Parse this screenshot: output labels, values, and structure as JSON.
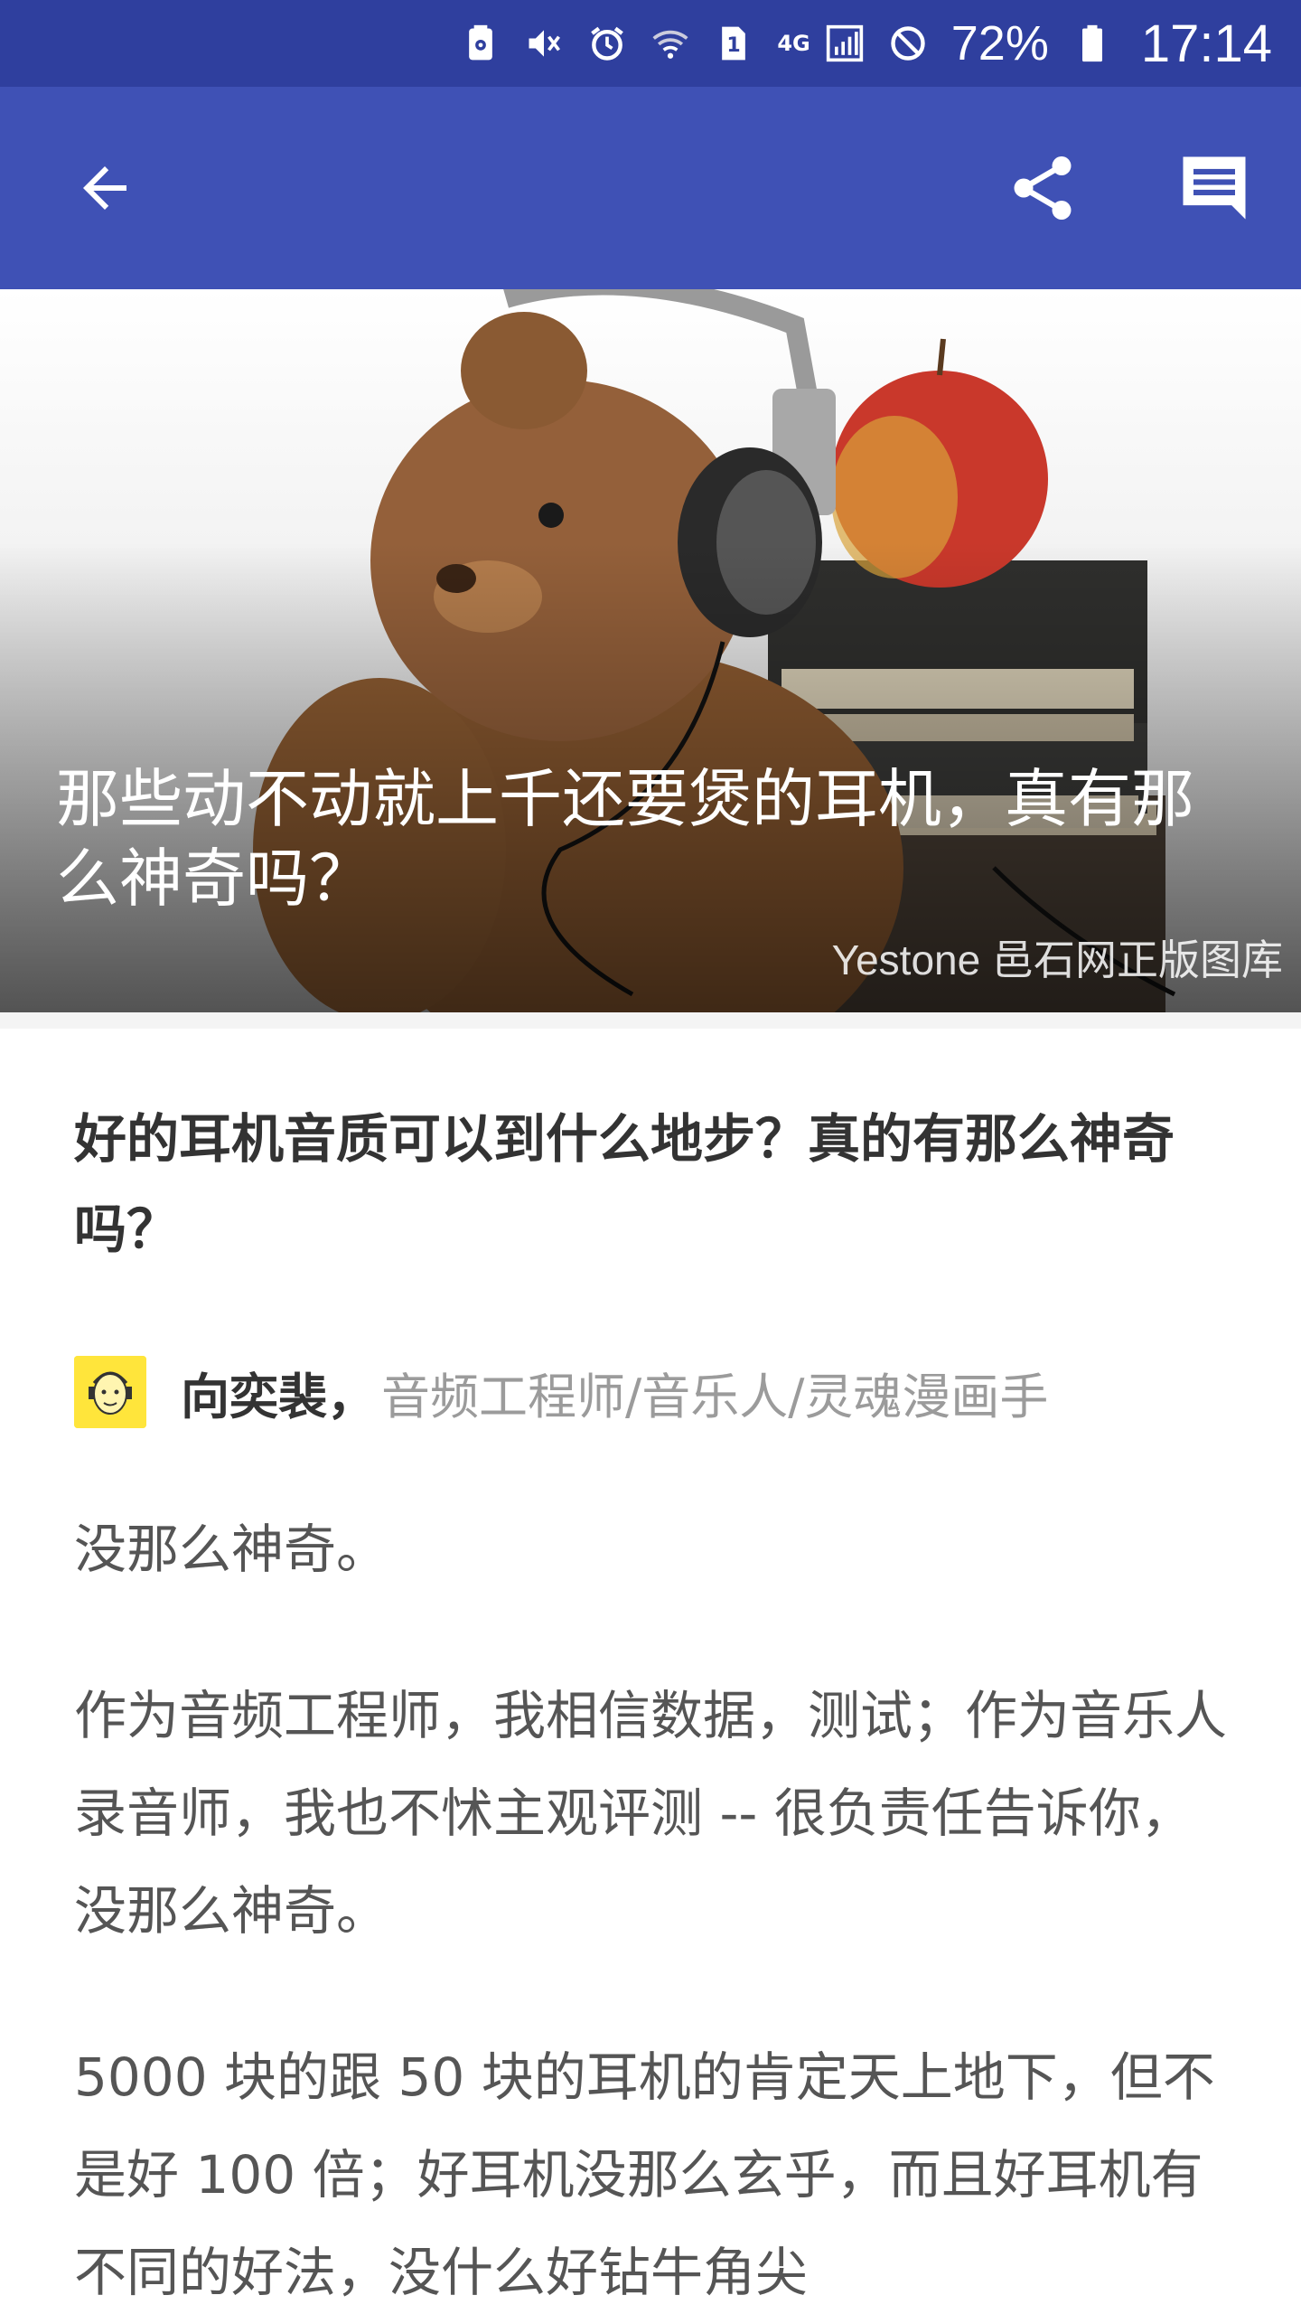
{
  "status_bar": {
    "network_label": "4G",
    "sim_slot": "1",
    "battery": "72%",
    "time": "17:14",
    "icons": [
      "nfc-icon",
      "mute-icon",
      "alarm-icon",
      "wifi-icon",
      "sim-icon",
      "signal-icon",
      "do-not-disturb-icon",
      "battery-icon"
    ]
  },
  "app_bar": {
    "background": "#3f51b5",
    "icons": [
      "back-arrow-icon",
      "share-icon",
      "comment-icon"
    ]
  },
  "hero": {
    "title": "那些动不动就上千还要煲的耳机，真有那么神奇吗？",
    "credit": "Yestone 邑石网正版图库"
  },
  "article": {
    "question_title": "好的耳机音质可以到什么地步？真的有那么神奇吗？",
    "author": {
      "name": "向奕裴",
      "separator": "，",
      "bio": "音频工程师/音乐人/灵魂漫画手"
    },
    "paragraphs": [
      "没那么神奇。",
      "作为音频工程师，我相信数据，测试；作为音乐人录音师，我也不怵主观评测 -- 很负责任告诉你，没那么神奇。",
      "5000 块的跟 50 块的耳机的肯定天上地下，但不是好 100 倍；好耳机没那么玄乎，而且好耳机有不同的好法，没什么好钻牛角尖"
    ]
  }
}
